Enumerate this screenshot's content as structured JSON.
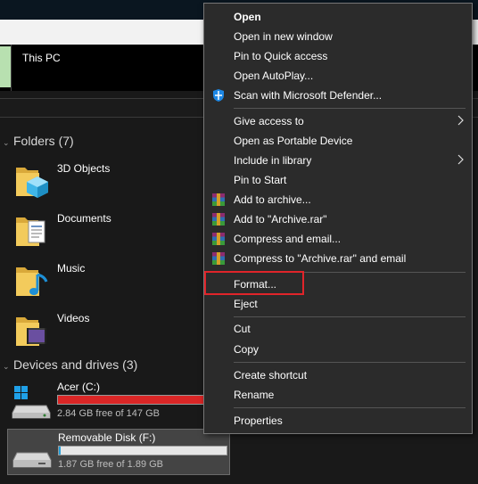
{
  "explorer": {
    "breadcrumb": "This PC",
    "folders_header": "Folders (7)",
    "folders": [
      {
        "label": "3D Objects",
        "icon": "3d-objects-folder-icon"
      },
      {
        "label": "Documents",
        "icon": "documents-folder-icon"
      },
      {
        "label": "Music",
        "icon": "music-folder-icon"
      },
      {
        "label": "Videos",
        "icon": "videos-folder-icon"
      }
    ],
    "devices_header": "Devices and drives (3)",
    "drives": [
      {
        "name": "Acer (C:)",
        "free": "2.84 GB free of 147 GB",
        "used_fraction": 0.98,
        "bar_color": "#da2626",
        "icon": "windows-drive-icon"
      },
      {
        "name": "Removable Disk (F:)",
        "free": "1.87 GB free of 1.89 GB",
        "used_fraction": 0.01,
        "bar_color": "#26a0da",
        "icon": "removable-drive-icon"
      }
    ]
  },
  "context_menu": {
    "items": [
      {
        "label": "Open",
        "bold": true
      },
      {
        "label": "Open in new window"
      },
      {
        "label": "Pin to Quick access"
      },
      {
        "label": "Open AutoPlay..."
      },
      {
        "label": "Scan with Microsoft Defender...",
        "icon": "defender-shield-icon"
      },
      {
        "label": "Give access to",
        "submenu": true
      },
      {
        "label": "Open as Portable Device"
      },
      {
        "label": "Include in library",
        "submenu": true
      },
      {
        "label": "Pin to Start"
      },
      {
        "label": "Add to archive...",
        "icon": "winrar-icon"
      },
      {
        "label": "Add to \"Archive.rar\"",
        "icon": "winrar-icon"
      },
      {
        "label": "Compress and email...",
        "icon": "winrar-icon"
      },
      {
        "label": "Compress to \"Archive.rar\" and email",
        "icon": "winrar-icon"
      },
      {
        "label": "Format...",
        "highlighted": true
      },
      {
        "label": "Eject"
      },
      {
        "label": "Cut"
      },
      {
        "label": "Copy"
      },
      {
        "label": "Create shortcut"
      },
      {
        "label": "Rename"
      },
      {
        "label": "Properties"
      }
    ]
  }
}
